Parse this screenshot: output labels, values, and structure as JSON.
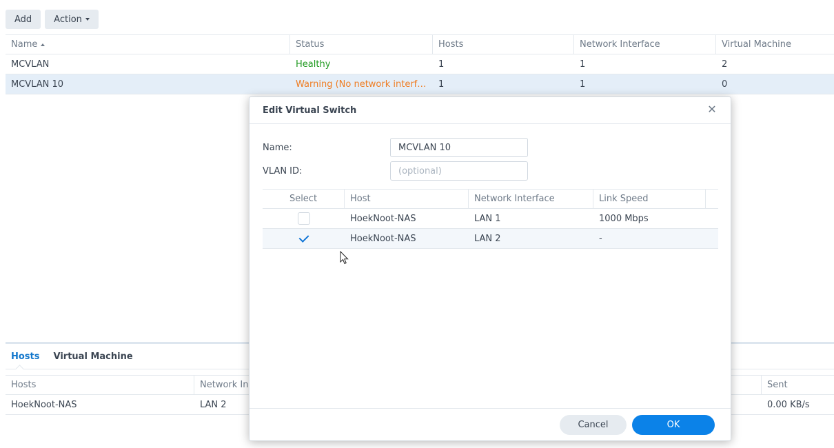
{
  "toolbar": {
    "add_label": "Add",
    "action_label": "Action"
  },
  "main_table": {
    "columns": [
      "Name",
      "Status",
      "Hosts",
      "Network Interface",
      "Virtual Machine"
    ],
    "sort": "Name ascending",
    "rows": [
      {
        "name": "MCVLAN",
        "status": "Healthy",
        "status_kind": "healthy",
        "hosts": "1",
        "network_interface": "1",
        "virtual_machine": "2",
        "selected": false
      },
      {
        "name": "MCVLAN 10",
        "status": "Warning (No network interf…",
        "status_kind": "warning",
        "hosts": "1",
        "network_interface": "1",
        "virtual_machine": "0",
        "selected": true
      }
    ]
  },
  "bottom_panel": {
    "tabs": [
      {
        "label": "Hosts",
        "active": true
      },
      {
        "label": "Virtual Machine",
        "active": false
      }
    ],
    "columns": [
      "Hosts",
      "Network In",
      "Sent"
    ],
    "rows": [
      {
        "host": "HoekNoot-NAS",
        "network_interface": "LAN 2",
        "sent": "0.00 KB/s"
      }
    ]
  },
  "dialog": {
    "title": "Edit Virtual Switch",
    "name_label": "Name:",
    "name_value": "MCVLAN 10",
    "vlan_label": "VLAN ID:",
    "vlan_placeholder": "(optional)",
    "columns": [
      "Select",
      "Host",
      "Network Interface",
      "Link Speed"
    ],
    "rows": [
      {
        "selected": false,
        "host": "HoekNoot-NAS",
        "network_interface": "LAN 1",
        "link_speed": "1000 Mbps"
      },
      {
        "selected": true,
        "host": "HoekNoot-NAS",
        "network_interface": "LAN 2",
        "link_speed": "-"
      }
    ],
    "cancel_label": "Cancel",
    "ok_label": "OK"
  },
  "colors": {
    "accent": "#0b82e8",
    "healthy": "#1f9a1f",
    "warning": "#ef7d23",
    "selected_row": "#e4eef8"
  }
}
